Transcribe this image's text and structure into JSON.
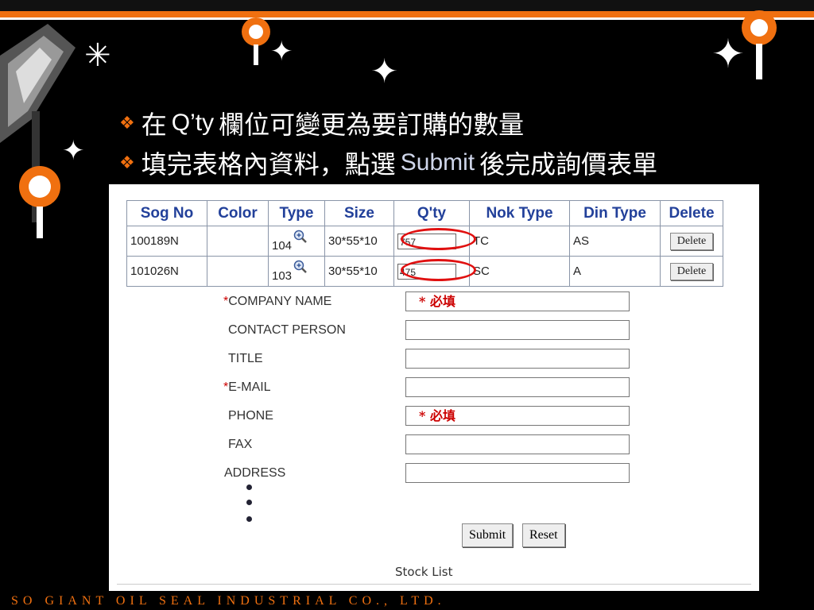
{
  "slide": {
    "bullets": [
      {
        "before": "在 ",
        "latin": "Q’ty",
        "after": " 欄位可變更為要訂購的數量"
      },
      {
        "before": "填完表格內資料，點選 ",
        "latin": "Submit",
        "after": " 後完成詢價表單"
      }
    ],
    "bullet_symbol": "❖",
    "footer": "SO GIANT OIL SEAL INDUSTRIAL CO., LTD."
  },
  "table": {
    "headers": [
      "Sog No",
      "Color",
      "Type",
      "Size",
      "Q'ty",
      "Nok Type",
      "Din Type",
      "Delete"
    ],
    "rows": [
      {
        "sog_no": "100189N",
        "color": "",
        "type": "104",
        "size": "30*55*10",
        "qty": "757",
        "nok_type": "TC",
        "din_type": "AS",
        "delete": "Delete"
      },
      {
        "sog_no": "101026N",
        "color": "",
        "type": "103",
        "size": "30*55*10",
        "qty": "475",
        "nok_type": "SC",
        "din_type": "A",
        "delete": "Delete"
      }
    ]
  },
  "form": {
    "required_mark": "*",
    "fields": [
      {
        "label": "COMPANY NAME",
        "required": true,
        "value": "* 必填"
      },
      {
        "label": "CONTACT PERSON",
        "required": false,
        "value": ""
      },
      {
        "label": "TITLE",
        "required": false,
        "value": ""
      },
      {
        "label": "E-MAIL",
        "required": true,
        "value": ""
      },
      {
        "label": "PHONE",
        "required": false,
        "value": "* 必填"
      },
      {
        "label": "FAX",
        "required": false,
        "value": ""
      },
      {
        "label": "ADDRESS",
        "required": false,
        "value": ""
      }
    ],
    "submit_label": "Submit",
    "reset_label": "Reset",
    "stock_list_label": "Stock List"
  },
  "colors": {
    "accent_orange": "#f07010",
    "highlight_red": "#e01010",
    "header_blue": "#22409a"
  },
  "icons": [
    "magnifier-icon",
    "sparkle-icon",
    "guitar-image",
    "ornament-icon"
  ]
}
